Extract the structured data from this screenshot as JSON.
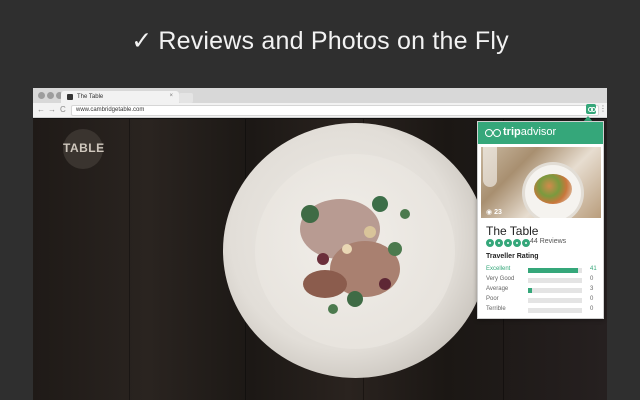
{
  "headline": {
    "check_glyph": "✓",
    "text": "Reviews and Photos on the Fly"
  },
  "browser": {
    "tab_title": "The Table",
    "tab_close": "×",
    "url": "www.cambridgetable.com",
    "nav_back": "←",
    "nav_forward": "→",
    "nav_reload": "C",
    "menu": "⋮"
  },
  "site_logo": {
    "title": "TABLE"
  },
  "popup": {
    "brand_prefix": "trip",
    "brand_suffix": "advisor",
    "photo_count": "23",
    "name": "The Table",
    "reviews_count": "44 Reviews",
    "rating_title": "Traveller Rating",
    "bubble_rating": 5,
    "ratings": [
      {
        "label": "Excellent",
        "count": "41",
        "fraction": 0.93,
        "highlight": true
      },
      {
        "label": "Very Good",
        "count": "0",
        "fraction": 0,
        "highlight": false
      },
      {
        "label": "Average",
        "count": "3",
        "fraction": 0.07,
        "highlight": false
      },
      {
        "label": "Poor",
        "count": "0",
        "fraction": 0,
        "highlight": false
      },
      {
        "label": "Terrible",
        "count": "0",
        "fraction": 0,
        "highlight": false
      }
    ]
  },
  "colors": {
    "brand_green": "#35a77a",
    "page_background": "#2f2f2f",
    "headline": "#f2f2f2"
  }
}
